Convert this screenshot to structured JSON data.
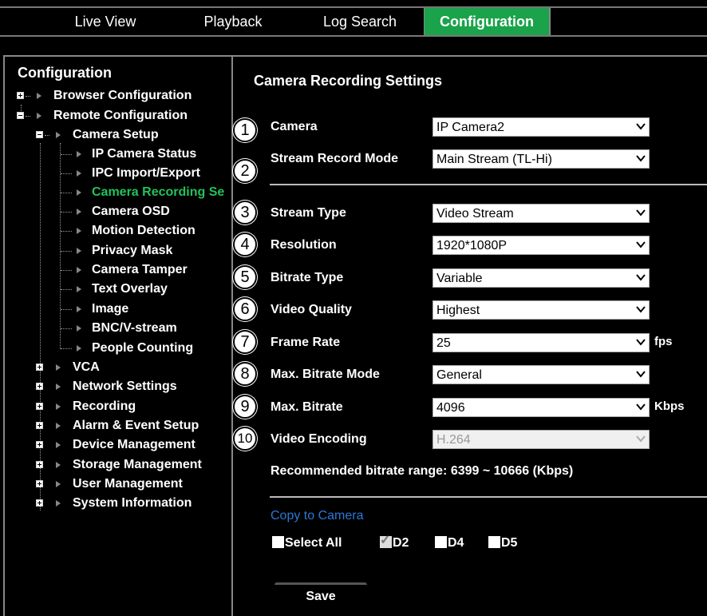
{
  "tabs": [
    {
      "label": "Live View",
      "active": false
    },
    {
      "label": "Playback",
      "active": false
    },
    {
      "label": "Log Search",
      "active": false
    },
    {
      "label": "Configuration",
      "active": true
    }
  ],
  "tree": {
    "title": "Configuration",
    "browser_configuration": "Browser Configuration",
    "remote_configuration": "Remote Configuration",
    "camera_setup": "Camera Setup",
    "camera_children": [
      "IP Camera Status",
      "IPC Import/Export",
      "Camera Recording Se",
      "Camera OSD",
      "Motion Detection",
      "Privacy Mask",
      "Camera Tamper",
      "Text Overlay",
      "Image",
      "BNC/V-stream",
      "People Counting"
    ],
    "remote_children": [
      "VCA",
      "Network Settings",
      "Recording",
      "Alarm & Event Setup",
      "Device Management",
      "Storage Management",
      "User Management",
      "System Information"
    ]
  },
  "panel": {
    "title": "Camera Recording Settings",
    "fields": [
      {
        "badge": "1",
        "label": "Camera",
        "value": "IP Camera2",
        "unit": ""
      },
      {
        "badge": "2",
        "label": "Stream Record Mode",
        "value": "Main Stream (TL-Hi)",
        "unit": ""
      },
      {
        "badge": "3",
        "label": "Stream Type",
        "value": "Video Stream",
        "unit": ""
      },
      {
        "badge": "4",
        "label": "Resolution",
        "value": "1920*1080P",
        "unit": ""
      },
      {
        "badge": "5",
        "label": "Bitrate Type",
        "value": "Variable",
        "unit": ""
      },
      {
        "badge": "6",
        "label": "Video Quality",
        "value": "Highest",
        "unit": ""
      },
      {
        "badge": "7",
        "label": "Frame Rate",
        "value": "25",
        "unit": "fps"
      },
      {
        "badge": "8",
        "label": "Max. Bitrate Mode",
        "value": "General",
        "unit": ""
      },
      {
        "badge": "9",
        "label": "Max. Bitrate",
        "value": "4096",
        "unit": "Kbps"
      },
      {
        "badge": "10",
        "label": "Video Encoding",
        "value": "H.264",
        "unit": ""
      }
    ],
    "recommended": "Recommended bitrate range: 6399 ~ 10666 (Kbps)",
    "copy_title": "Copy to Camera",
    "checkboxes": [
      {
        "label": "Select All",
        "checked": false
      },
      {
        "label": "D2",
        "checked": true
      },
      {
        "label": "D4",
        "checked": false
      },
      {
        "label": "D5",
        "checked": false
      }
    ],
    "save_label": "Save"
  },
  "colors": {
    "accent": "#1aa34a",
    "selected_text": "#22c25a",
    "link": "#2a78d6",
    "background": "#000000"
  }
}
